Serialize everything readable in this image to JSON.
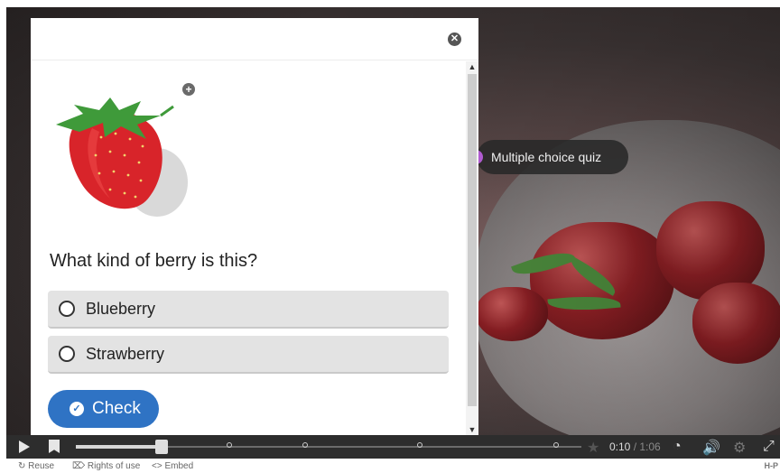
{
  "interaction_tag": {
    "label": "Multiple choice quiz"
  },
  "dialog": {
    "close_symbol": "✕",
    "zoom_symbol": "+",
    "question": "What kind of berry is this?",
    "answers": [
      {
        "label": "Blueberry"
      },
      {
        "label": "Strawberry"
      }
    ],
    "check_label": "Check",
    "check_symbol": "✓"
  },
  "player": {
    "elapsed": "0:10",
    "total": "1:06",
    "progress_fraction": 0.17,
    "icons": [
      "play-icon",
      "bookmark-icon",
      "star-icon",
      "speedometer-icon",
      "volume-icon",
      "gear-icon",
      "fullscreen-icon"
    ]
  },
  "footer": {
    "reuse_label": "Reuse",
    "rights_label": "Rights of use",
    "embed_label": "Embed",
    "brand": "H-P"
  },
  "colors": {
    "accent": "#2f73c4",
    "tag_bg": "#282828",
    "tag_marker": "#b05bd0"
  }
}
